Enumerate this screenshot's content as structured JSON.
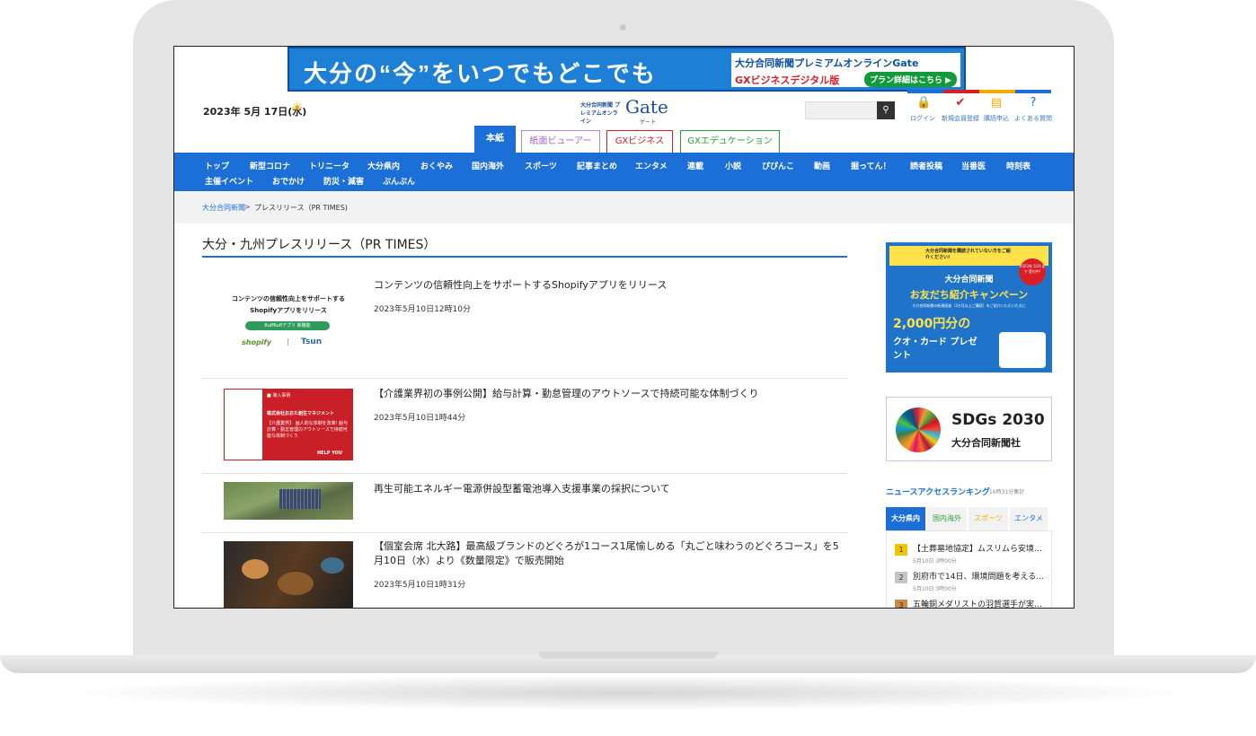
{
  "banner": {
    "headline": "大分の“今”をいつでもどこでも",
    "box_line1": "大分合同新聞プレミアムオンラインGate",
    "box_line2": "GXビジネスデジタル版",
    "button": "プラン詳細はこちら ▶"
  },
  "header": {
    "date": "2023年 5月 17日(水)",
    "weather_icon": "sun-icon",
    "logo_small": "大分合同新聞 プレミアムオンライン",
    "logo_main": "Gate",
    "logo_sub": "ゲート",
    "utility": [
      {
        "label": "ログイン",
        "icon": "lock-icon"
      },
      {
        "label": "新規会員登録",
        "icon": "check-circle-icon"
      },
      {
        "label": "購読申込",
        "icon": "document-icon"
      },
      {
        "label": "よくある質問",
        "icon": "question-icon"
      }
    ]
  },
  "tabs": [
    "本紙",
    "紙面ビューアー",
    "GXビジネス",
    "GXエデュケーション"
  ],
  "nav": {
    "row1": [
      "トップ",
      "新型コロナ",
      "トリニータ",
      "大分県内",
      "おくやみ",
      "国内海外",
      "スポーツ",
      "記事まとめ",
      "エンタメ",
      "連載",
      "小説",
      "ぴぴんこ",
      "動画",
      "掘ってん！",
      "読者投稿",
      "当番医",
      "時刻表"
    ],
    "row2": [
      "主催イベント",
      "おでかけ",
      "防災・減害",
      "ぷんぷん"
    ]
  },
  "breadcrumb": {
    "home": "大分合同新聞",
    "sep": ">",
    "current": "プレスリリース（PR TIMES)"
  },
  "page_title": "大分・九州プレスリリース（PR TIMES）",
  "articles": [
    {
      "title": "コンテンツの信頼性向上をサポートするShopifyアプリをリリース",
      "date": "2023年5月10日12時10分",
      "thumb": {
        "line1": "コンテンツの信頼性向上をサポートする",
        "line2": "Shopifyアプリをリリース",
        "pill": "RuffRuffアプリ 新機能",
        "brand1": "shopify",
        "brand2": "Tsun"
      }
    },
    {
      "title": "【介護業界初の事例公開】給与計算・勤怠管理のアウトソースで持続可能な体制づくり",
      "date": "2023年5月10日1時44分",
      "thumb": {
        "tag": "■ 導入事例",
        "company": "株式会社おおた創生マネジメント",
        "text": "【介護業界】 画人的な体制を改革! 給与計算・勤怠管理のアウトソースで持続可能な体制づくり",
        "brand": "HELP YOU"
      }
    },
    {
      "title": "再生可能エネルギー電源併設型蓄電池導入支援事業の採択について",
      "date": "",
      "thumb": {}
    },
    {
      "title": "【個室会席 北大路】最高級ブランドのどぐろが1コース1尾愉しめる「丸ごと味わうのどぐろコース」を5月10日（水）より《数量限定》で販売開始",
      "date": "2023年5月10日1時31分",
      "thumb": {}
    }
  ],
  "sidebar": {
    "ad1": {
      "top": "大分合同新聞を購読されていない方をご紹介ください!",
      "badge": "2023年 5/31まで 受付中!",
      "title1": "大分合同新聞",
      "title2": "お友だち紹介キャンペーン",
      "desc": "大分合同新聞の新規読者（3カ月以上ご購読）をご紹介いただいた方に",
      "amount": "2,000円分の",
      "gift": "クオ・カード プレゼント"
    },
    "ad2": {
      "title": "SDGs 2030",
      "sub": "大分合同新聞社"
    },
    "ranking_title": "ニュースアクセスランキング",
    "ranking_note": "16時31分集計",
    "ranking_tabs": [
      "大分県内",
      "国内海外",
      "スポーツ",
      "エンタメ"
    ],
    "ranking": [
      {
        "rank": "1",
        "title": "【土葬墓地協定】ムスリムら安境…",
        "meta": "5月10日 3時00分"
      },
      {
        "rank": "2",
        "title": "別府市で14日、環境問題を考える…",
        "meta": "5月10日 3時00分"
      },
      {
        "rank": "3",
        "title": "五輪銅メダリストの羽賀選手が実…",
        "meta": ""
      }
    ]
  }
}
